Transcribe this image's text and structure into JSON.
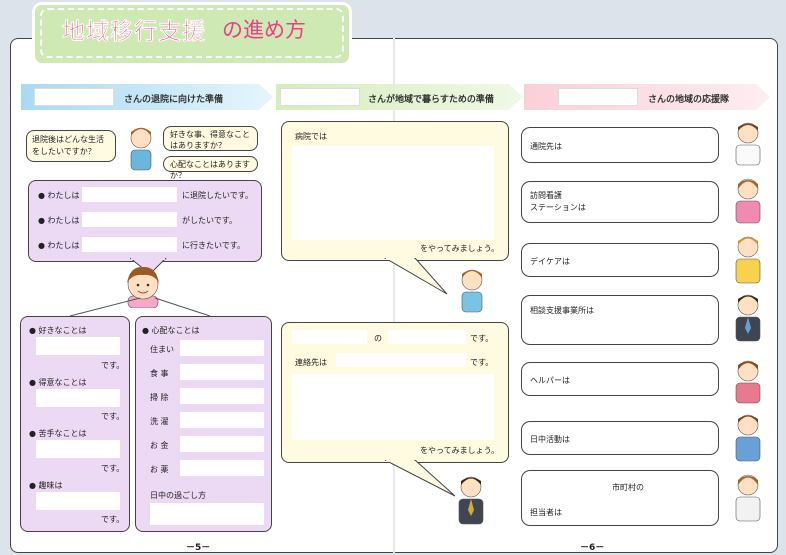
{
  "title": {
    "main": "地域移行支援",
    "sub": "の進め方"
  },
  "headers": {
    "h1": "さんの退院に向けた準備",
    "h2": "さんが地域で暮らすための準備",
    "h3": "さんの地域の応援隊"
  },
  "speech": {
    "s1": "退院後はどんな生活をしたいですか？",
    "s2": "好きな事、得意なことはありますか？",
    "s3": "心配なことはありますか？"
  },
  "wishes": {
    "w1_pre": "● わたしは",
    "w1_post": "に退院したいです。",
    "w2_pre": "● わたしは",
    "w2_post": "がしたいです。",
    "w3_pre": "● わたしは",
    "w3_post": "に行きたいです。"
  },
  "likes": [
    {
      "label": "● 好きなことは"
    },
    {
      "label": "● 得意なことは"
    },
    {
      "label": "● 苦手なことは"
    },
    {
      "label": "● 趣味は"
    }
  ],
  "desu": "です。",
  "worries": {
    "header": "● 心配なことは",
    "items": [
      "住まい",
      "食 事",
      "掃 除",
      "洗 濯",
      "お 金",
      "お 薬",
      "日中の過ごし方"
    ]
  },
  "hospital": {
    "label": "病院では",
    "footer": "をやってみましょう。"
  },
  "contact": {
    "no": "の",
    "desu1": "です。",
    "renraku": "連絡先は",
    "desu2": "です。",
    "footer": "をやってみましょう。"
  },
  "support": {
    "s1": "通院先は",
    "s2": "訪問看護\nステーションは",
    "s3": "デイケアは",
    "s4": "相談支援事業所は",
    "s5": "ヘルパーは",
    "s6": "日中活動は",
    "s7a": "市町村の",
    "s7b": "担当者は"
  },
  "pages": {
    "left": "－5－",
    "right": "－6－"
  }
}
